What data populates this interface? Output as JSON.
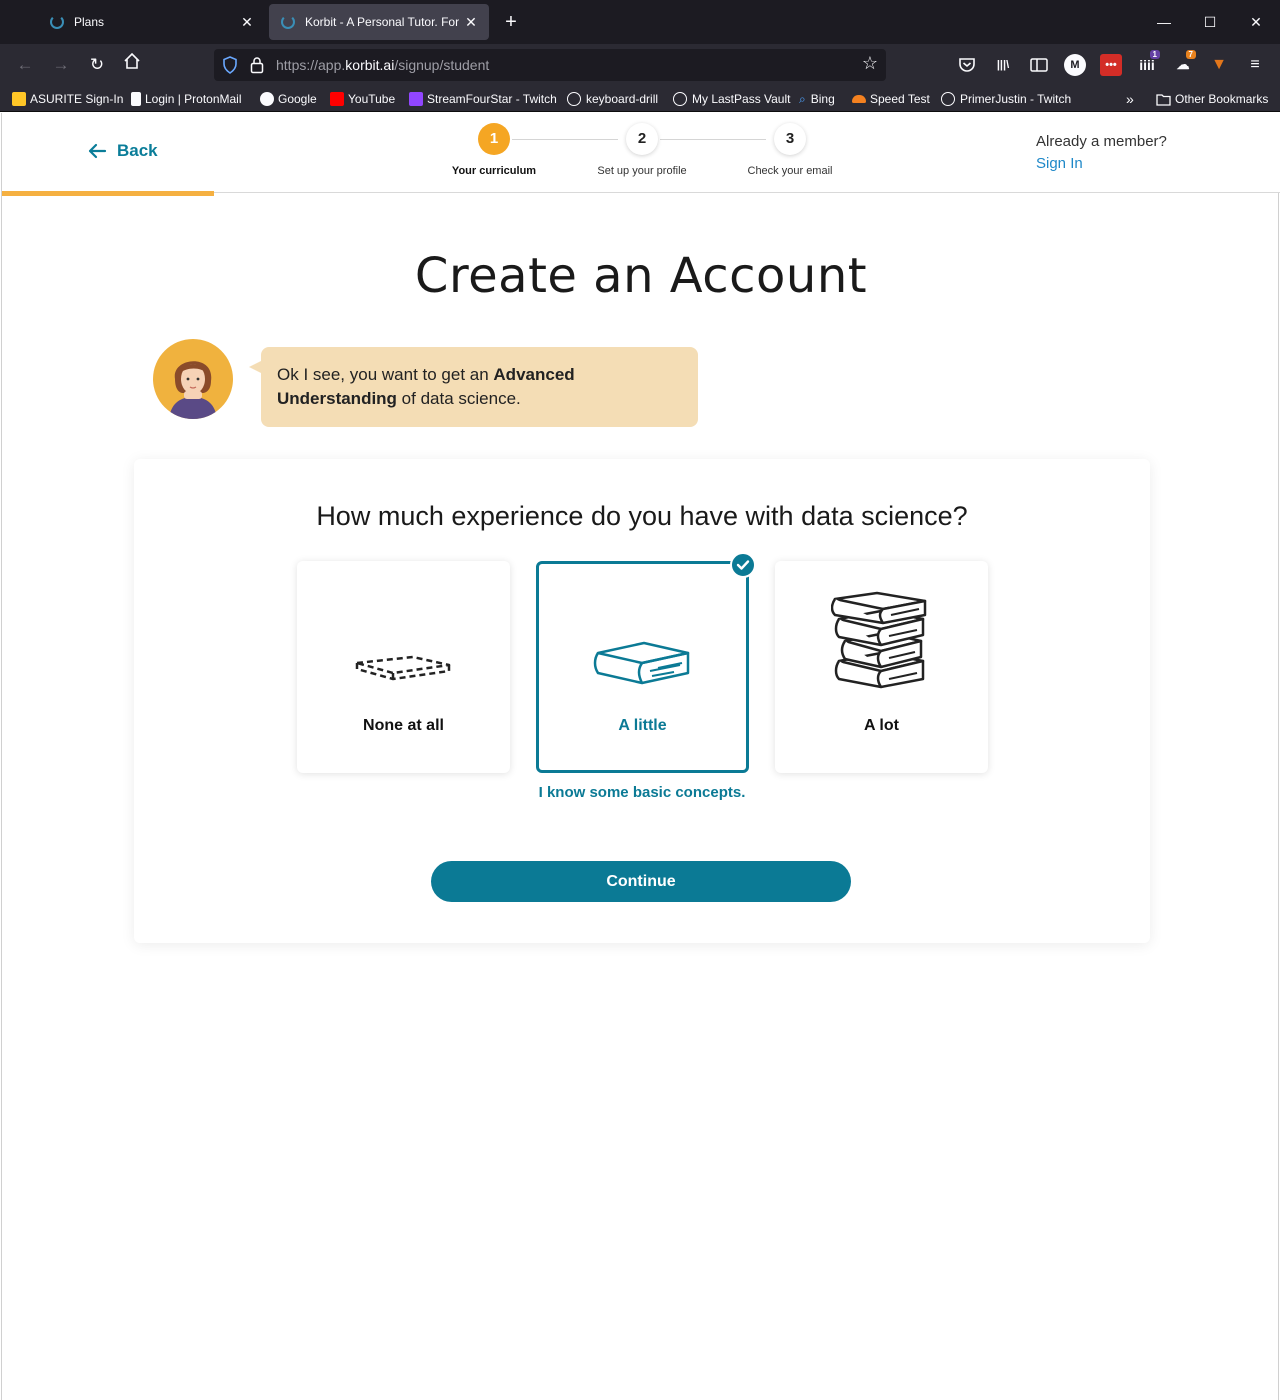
{
  "browser": {
    "tabs": [
      {
        "title": "Plans",
        "active": false
      },
      {
        "title": "Korbit - A Personal Tutor. For Ev",
        "active": true
      }
    ],
    "url": {
      "prefix": "https://app.",
      "domain": "korbit.ai",
      "path": "/signup/student"
    },
    "bookmarks": [
      "ASURITE Sign-In",
      "Login | ProtonMail",
      "Google",
      "YouTube",
      "StreamFourStar - Twitch",
      "keyboard-drill",
      "My LastPass Vault",
      "Bing",
      "Speed Test",
      "PrimerJustin - Twitch",
      "Other Bookmarks"
    ],
    "extension_badges": {
      "twitch": "1",
      "fox": "7"
    },
    "accent_color": "#1c1b22"
  },
  "header": {
    "back_label": "Back",
    "steps": [
      {
        "number": "1",
        "label": "Your curriculum",
        "active": true
      },
      {
        "number": "2",
        "label": "Set up your profile",
        "active": false
      },
      {
        "number": "3",
        "label": "Check your email",
        "active": false
      }
    ],
    "already_member": "Already a member?",
    "sign_in": "Sign In"
  },
  "main": {
    "title": "Create an Account",
    "bubble": {
      "part1": "Ok I see, you want to get an ",
      "bold1": "Advanced Understanding",
      "part2": " of data science."
    },
    "question": "How much experience do you have with data science?",
    "options": [
      {
        "label": "None at all",
        "icon": "empty-book-outline-icon",
        "selected": false
      },
      {
        "label": "A little",
        "icon": "single-book-icon",
        "selected": true
      },
      {
        "label": "A lot",
        "icon": "book-stack-icon",
        "selected": false
      }
    ],
    "hint": "I know some basic concepts.",
    "continue_label": "Continue"
  },
  "colors": {
    "primary": "#0b7a95",
    "step_active": "#f5a623",
    "bubble_bg": "#f4ddb5",
    "sign_in_link": "#1e88c8",
    "progress": "#f5b041"
  }
}
